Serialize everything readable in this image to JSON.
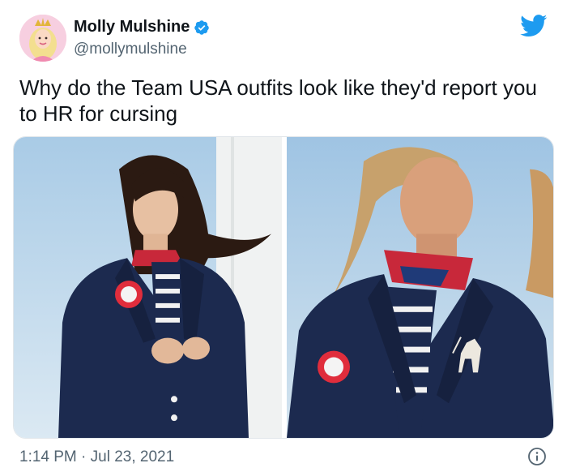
{
  "author": {
    "display_name": "Molly Mulshine",
    "handle": "@mollymulshine",
    "verified_icon": "verified-badge-icon"
  },
  "tweet": {
    "text": "Why do the Team USA outfits look like they'd report you to HR for cursing"
  },
  "meta": {
    "time": "1:14 PM",
    "separator": "·",
    "date": "Jul 23, 2021"
  },
  "icons": {
    "brand": "twitter-bird-icon",
    "info": "info-icon"
  },
  "colors": {
    "twitter_blue": "#1d9bf0",
    "text_primary": "#0f1419",
    "text_secondary": "#536471",
    "jacket_navy": "#1c2a4f"
  }
}
